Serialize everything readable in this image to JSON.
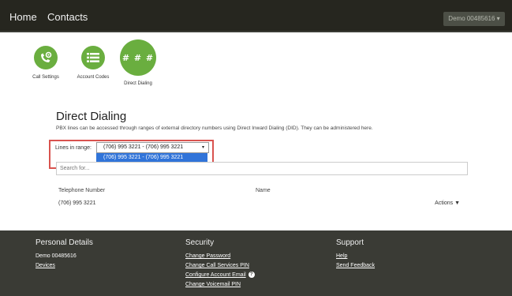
{
  "nav": {
    "home": "Home",
    "contacts": "Contacts",
    "account": "Demo 00485616 ▾"
  },
  "icons": [
    {
      "label": "Call Settings",
      "icon": "phone-gear-icon"
    },
    {
      "label": "Account Codes",
      "icon": "list-icon"
    },
    {
      "label": "Direct Dialing",
      "icon": "hash-icon",
      "glyph": "# # #"
    }
  ],
  "page": {
    "title": "Direct Dialing",
    "description": "PBX lines can be accessed through ranges of external directory numbers using Direct Inward Dialing (DID). They can be administered here."
  },
  "range": {
    "label": "Lines in range:",
    "selected": "(706) 995 3221 - (706) 995 3221",
    "arrow": "▾",
    "options": [
      "(706) 995 3221 - (706) 995 3221"
    ]
  },
  "search": {
    "placeholder": "Search for..."
  },
  "table": {
    "headers": [
      "Telephone Number",
      "Name"
    ],
    "rows": [
      {
        "telephone": "(706) 995 3221",
        "name": ""
      }
    ],
    "actions_label": "Actions ▼"
  },
  "footer": {
    "personal": {
      "title": "Personal Details",
      "items": [
        "Demo 00485616",
        "Devices"
      ]
    },
    "security": {
      "title": "Security",
      "items": [
        "Change Password",
        "Change Call Services PIN",
        "Configure Account Email",
        "Change Voicemail PIN"
      ]
    },
    "support": {
      "title": "Support",
      "items": [
        "Help",
        "Send Feedback"
      ]
    }
  },
  "colors": {
    "accent_green": "#6aae3f",
    "highlight_red": "#d9534f",
    "option_blue": "#3174d9"
  }
}
